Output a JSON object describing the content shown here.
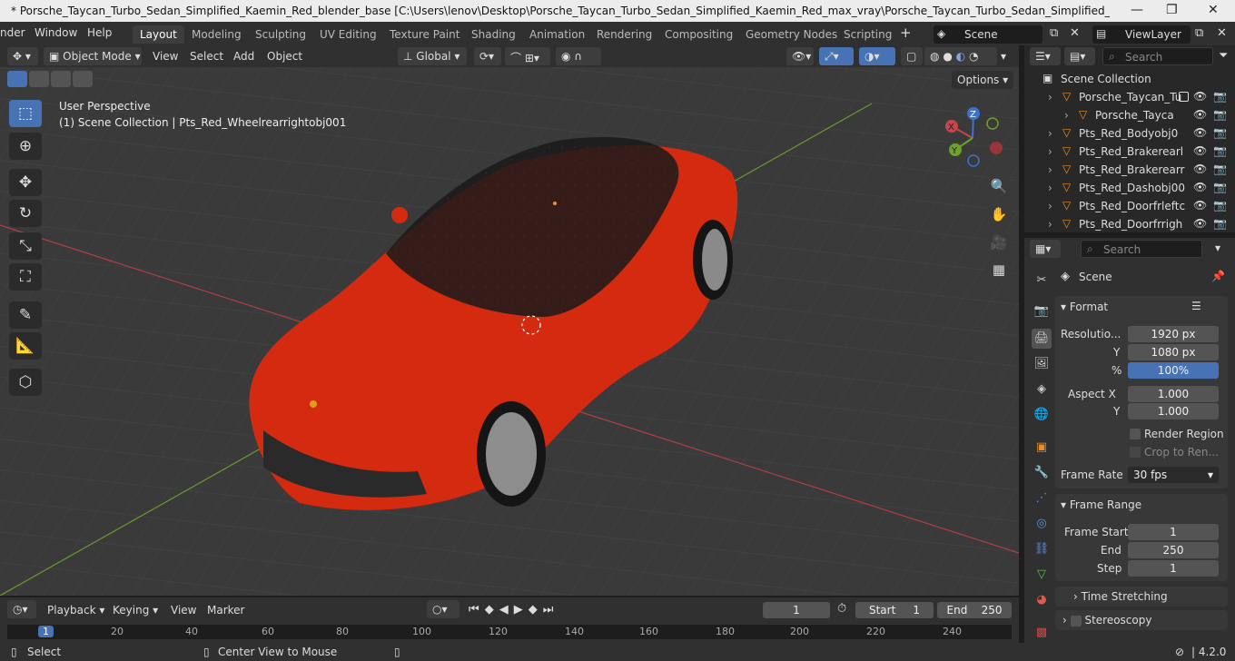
{
  "titlebar": {
    "title": "* Porsche_Taycan_Turbo_Sedan_Simplified_Kaemin_Red_blender_base [C:\\Users\\lenov\\Desktop\\Porsche_Taycan_Turbo_Sedan_Simplified_Kaemin_Red_max_vray\\Porsche_Taycan_Turbo_Sedan_Simplified_Kaemin_Red_blender_...",
    "minimize": "—",
    "restore": "❐",
    "close": "✕"
  },
  "menubar": {
    "items": [
      "nder",
      "Window",
      "Help"
    ]
  },
  "workspaces": [
    "Layout",
    "Modeling",
    "Sculpting",
    "UV Editing",
    "Texture Paint",
    "Shading",
    "Animation",
    "Rendering",
    "Compositing",
    "Geometry Nodes",
    "Scripting"
  ],
  "add_workspace": "+",
  "scene": {
    "name": "Scene",
    "viewlayer": "ViewLayer"
  },
  "viewport_header": {
    "mode": "Object Mode",
    "menus": [
      "View",
      "Select",
      "Add",
      "Object"
    ],
    "transform_orientation": "Global",
    "options": "Options"
  },
  "viewport": {
    "perspective": "User Perspective",
    "context": "(1) Scene Collection | Pts_Red_Wheelrearrightobj001",
    "gizmo": {
      "x": "X",
      "y": "Y",
      "z": "Z"
    }
  },
  "outliner": {
    "search_placeholder": "Search",
    "root": "Scene Collection",
    "rows": [
      {
        "label": "Porsche_Taycan_Tu",
        "indent": 1
      },
      {
        "label": "Porsche_Tayca",
        "indent": 2
      },
      {
        "label": "Pts_Red_Bodyobj0",
        "indent": 1
      },
      {
        "label": "Pts_Red_Brakerearl",
        "indent": 1
      },
      {
        "label": "Pts_Red_Brakerearr",
        "indent": 1
      },
      {
        "label": "Pts_Red_Dashobj00",
        "indent": 1
      },
      {
        "label": "Pts_Red_Doorfrleftc",
        "indent": 1
      },
      {
        "label": "Pts_Red_Doorfrrigh",
        "indent": 1
      }
    ]
  },
  "properties": {
    "search_placeholder": "Search",
    "context": "Scene",
    "format": {
      "header": "Format",
      "resolution_label": "Resolutio...",
      "res_x": "1920 px",
      "y_label": "Y",
      "res_y": "1080 px",
      "pct_label": "%",
      "res_pct": "100%",
      "aspect_label": "Aspect X",
      "aspect_x": "1.000",
      "aspect_y": "1.000",
      "render_region": "Render Region",
      "crop": "Crop to Ren...",
      "frame_rate_label": "Frame Rate",
      "frame_rate": "30 fps"
    },
    "frame_range": {
      "header": "Frame Range",
      "start_label": "Frame Start",
      "start": "1",
      "end_label": "End",
      "end": "250",
      "step_label": "Step",
      "step": "1"
    },
    "time_stretching": "Time Stretching",
    "stereoscopy": "Stereoscopy"
  },
  "timeline": {
    "menus": [
      "Playback",
      "Keying",
      "View",
      "Marker"
    ],
    "current_frame": "1",
    "start_label": "Start",
    "start": "1",
    "end_label": "End",
    "end": "250",
    "ruler": [
      "1",
      "20",
      "40",
      "60",
      "80",
      "100",
      "120",
      "140",
      "160",
      "180",
      "200",
      "220",
      "240"
    ]
  },
  "statusbar": {
    "select": "Select",
    "center_view": "Center View to Mouse",
    "version": "4.2.0"
  },
  "colors": {
    "accent": "#4772b3",
    "car_body": "#d42a10",
    "axis_x": "#c8454b",
    "axis_y": "#6fa02b",
    "axis_z": "#3a73d2"
  }
}
